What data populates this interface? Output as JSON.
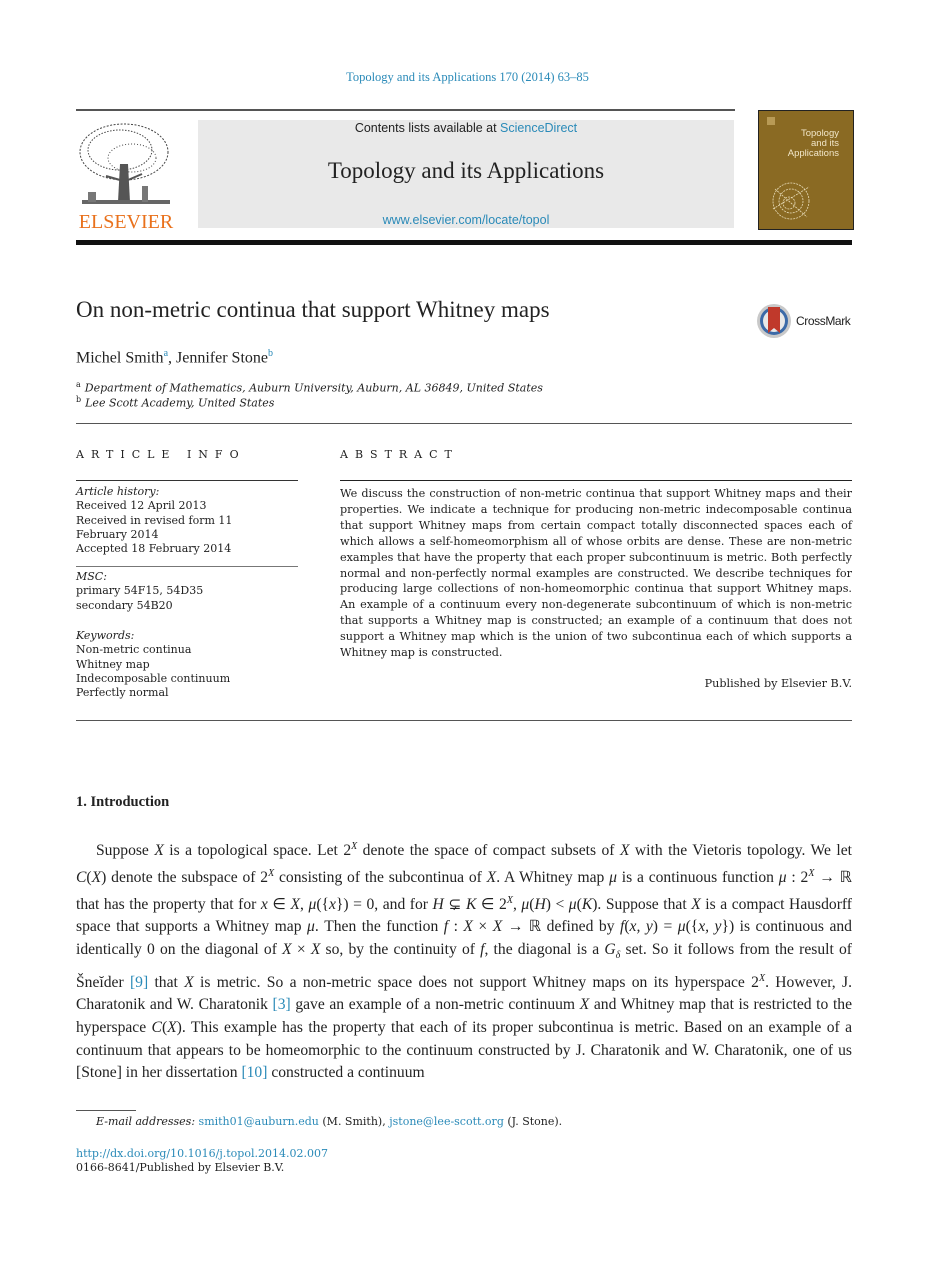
{
  "header": {
    "journal_ref": "Topology and its Applications 170 (2014) 63–85",
    "publisher_logo_text": "ELSEVIER",
    "contents_prefix": "Contents lists available at ",
    "contents_link": "ScienceDirect",
    "journal_title": "Topology and its Applications",
    "journal_url": "www.elsevier.com/locate/topol",
    "cover_title_lines": [
      "Topology",
      "and its",
      "Applications"
    ]
  },
  "article": {
    "title": "On non-metric continua that support Whitney maps",
    "crossmark_label": "CrossMark",
    "authors": [
      {
        "name": "Michel Smith",
        "sup": "a"
      },
      {
        "name": "Jennifer Stone",
        "sup": "b"
      }
    ],
    "author_separator": ", ",
    "affiliations": [
      {
        "sup": "a",
        "text": "Department of Mathematics, Auburn University, Auburn, AL 36849, United States"
      },
      {
        "sup": "b",
        "text": "Lee Scott Academy, United States"
      }
    ]
  },
  "article_info": {
    "heading": "ARTICLE INFO",
    "history_label": "Article history:",
    "history": [
      "Received 12 April 2013",
      "Received in revised form 11",
      "February 2014",
      "Accepted 18 February 2014"
    ],
    "msc_label": "MSC:",
    "msc": [
      "primary 54F15, 54D35",
      "secondary 54B20"
    ],
    "keywords_label": "Keywords:",
    "keywords": [
      "Non-metric continua",
      "Whitney map",
      "Indecomposable continuum",
      "Perfectly normal"
    ]
  },
  "abstract": {
    "heading": "ABSTRACT",
    "text": "We discuss the construction of non-metric continua that support Whitney maps and their properties. We indicate a technique for producing non-metric indecomposable continua that support Whitney maps from certain compact totally disconnected spaces each of which allows a self-homeomorphism all of whose orbits are dense. These are non-metric examples that have the property that each proper subcontinuum is metric. Both perfectly normal and non-perfectly normal examples are constructed. We describe techniques for producing large collections of non-homeomorphic continua that support Whitney maps. An example of a continuum every non-degenerate subcontinuum of which is non-metric that supports a Whitney map is constructed; an example of a continuum that does not support a Whitney map which is the union of two subcontinua each of which supports a Whitney map is constructed.",
    "published": "Published by Elsevier B.V."
  },
  "introduction": {
    "heading": "1.  Introduction",
    "segments": [
      {
        "t": "Suppose "
      },
      {
        "m": "X"
      },
      {
        "t": " is a topological space. Let 2"
      },
      {
        "sup": "X"
      },
      {
        "t": " denote the space of compact subsets of "
      },
      {
        "m": "X"
      },
      {
        "t": " with the Vietoris topology. We let "
      },
      {
        "m": "C"
      },
      {
        "t": "("
      },
      {
        "m": "X"
      },
      {
        "t": ") denote the subspace of 2"
      },
      {
        "sup": "X"
      },
      {
        "t": " consisting of the subcontinua of "
      },
      {
        "m": "X"
      },
      {
        "t": ". A Whitney map "
      },
      {
        "m": "μ"
      },
      {
        "t": " is a continuous function "
      },
      {
        "m": "μ"
      },
      {
        "t": " : 2"
      },
      {
        "sup": "X"
      },
      {
        "t": " → ℝ that has the property that for "
      },
      {
        "m": "x"
      },
      {
        "t": " ∈ "
      },
      {
        "m": "X"
      },
      {
        "t": ", "
      },
      {
        "m": "μ"
      },
      {
        "t": "({"
      },
      {
        "m": "x"
      },
      {
        "t": "}) = 0, and for "
      },
      {
        "m": "H"
      },
      {
        "t": " ⊊ "
      },
      {
        "m": "K"
      },
      {
        "t": " ∈ 2"
      },
      {
        "sup": "X"
      },
      {
        "t": ", "
      },
      {
        "m": "μ"
      },
      {
        "t": "("
      },
      {
        "m": "H"
      },
      {
        "t": ") < "
      },
      {
        "m": "μ"
      },
      {
        "t": "("
      },
      {
        "m": "K"
      },
      {
        "t": "). Suppose that "
      },
      {
        "m": "X"
      },
      {
        "t": " is a compact Hausdorff space that supports a Whitney map "
      },
      {
        "m": "μ"
      },
      {
        "t": ". Then the function "
      },
      {
        "m": "f"
      },
      {
        "t": " : "
      },
      {
        "m": "X"
      },
      {
        "t": " × "
      },
      {
        "m": "X"
      },
      {
        "t": " → ℝ defined by "
      },
      {
        "m": "f"
      },
      {
        "t": "("
      },
      {
        "m": "x, y"
      },
      {
        "t": ") = "
      },
      {
        "m": "μ"
      },
      {
        "t": "({"
      },
      {
        "m": "x, y"
      },
      {
        "t": "}) is continuous and identically 0 on the diagonal of "
      },
      {
        "m": "X"
      },
      {
        "t": " × "
      },
      {
        "m": "X"
      },
      {
        "t": " so, by the continuity of "
      },
      {
        "m": "f"
      },
      {
        "t": ", the diagonal is a "
      },
      {
        "m": "G"
      },
      {
        "sub": "δ"
      },
      {
        "t": " set. So it follows from the result of Šneĭder "
      },
      {
        "ref": "[9]"
      },
      {
        "t": " that "
      },
      {
        "m": "X"
      },
      {
        "t": " is metric. So a non-metric space does not support Whitney maps on its hyperspace 2"
      },
      {
        "sup": "X"
      },
      {
        "t": ". However, J. Charatonik and W. Charatonik "
      },
      {
        "ref": "[3]"
      },
      {
        "t": " gave an example of a non-metric continuum "
      },
      {
        "m": "X"
      },
      {
        "t": " and Whitney map that is restricted to the hyperspace "
      },
      {
        "m": "C"
      },
      {
        "t": "("
      },
      {
        "m": "X"
      },
      {
        "t": "). This example has the property that each of its proper subcontinua is metric. Based on an example of a continuum that appears to be homeomorphic to the continuum constructed by J. Charatonik and W. Charatonik, one of us [Stone] in her dissertation "
      },
      {
        "ref": "[10]"
      },
      {
        "t": " constructed a continuum"
      }
    ]
  },
  "footnote": {
    "label": "E-mail addresses:",
    "email1": "smith01@auburn.edu",
    "name1": " (M. Smith), ",
    "email2": "jstone@lee-scott.org",
    "name2": " (J. Stone)."
  },
  "footer": {
    "doi": "http://dx.doi.org/10.1016/j.topol.2014.02.007",
    "issn": "0166-8641/Published by Elsevier B.V."
  },
  "colors": {
    "link": "#2a8ab8",
    "elsevier_orange": "#e9711c",
    "cover": "#8a6a23"
  }
}
